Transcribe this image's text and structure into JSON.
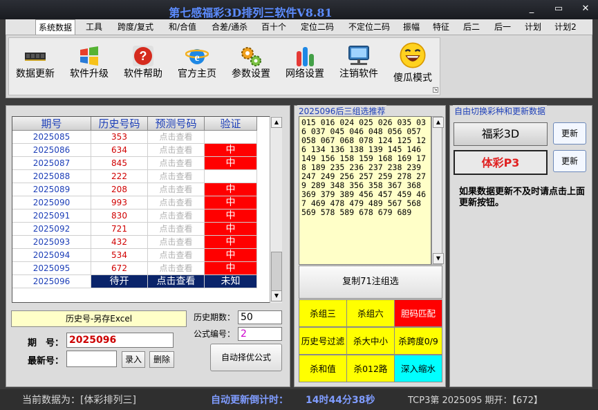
{
  "window": {
    "title": "第七感福彩3D排列三软件V8.81",
    "minimize": "_",
    "restore": "▭",
    "close": "✕"
  },
  "menu": [
    "系统数据",
    "工具",
    "跨度/复式",
    "和/合值",
    "合差/通杀",
    "百十个",
    "定位二码",
    "不定位二码",
    "振幅",
    "特征",
    "后二",
    "后一",
    "计划",
    "计划2"
  ],
  "toolbar": [
    {
      "label": "数据更新",
      "icon": "ram-chip-icon"
    },
    {
      "label": "软件升级",
      "icon": "windows-logo-icon"
    },
    {
      "label": "软件帮助",
      "icon": "help-question-icon"
    },
    {
      "label": "官方主页",
      "icon": "internet-explorer-icon"
    },
    {
      "label": "参数设置",
      "icon": "gears-icon"
    },
    {
      "label": "网络设置",
      "icon": "bar-chart-icon"
    },
    {
      "label": "注销软件",
      "icon": "monitor-network-icon"
    },
    {
      "label": "傻瓜模式",
      "icon": "laughing-face-icon"
    }
  ],
  "history": {
    "headers": [
      "期号",
      "历史号码",
      "预测号码",
      "验证"
    ],
    "rows": [
      {
        "period": "2025085",
        "history": "353",
        "predict": "点击查看",
        "verify": ""
      },
      {
        "period": "2025086",
        "history": "634",
        "predict": "点击查看",
        "verify": "中"
      },
      {
        "period": "2025087",
        "history": "845",
        "predict": "点击查看",
        "verify": "中"
      },
      {
        "period": "2025088",
        "history": "222",
        "predict": "点击查看",
        "verify": ""
      },
      {
        "period": "2025089",
        "history": "208",
        "predict": "点击查看",
        "verify": "中"
      },
      {
        "period": "2025090",
        "history": "993",
        "predict": "点击查看",
        "verify": "中"
      },
      {
        "period": "2025091",
        "history": "830",
        "predict": "点击查看",
        "verify": "中"
      },
      {
        "period": "2025092",
        "history": "721",
        "predict": "点击查看",
        "verify": "中"
      },
      {
        "period": "2025093",
        "history": "432",
        "predict": "点击查看",
        "verify": "中"
      },
      {
        "period": "2025094",
        "history": "534",
        "predict": "点击查看",
        "verify": "中"
      },
      {
        "period": "2025095",
        "history": "672",
        "predict": "点击查看",
        "verify": "中"
      },
      {
        "period": "2025096",
        "history": "待开",
        "predict": "点击查看",
        "verify": "未知"
      }
    ],
    "hit_color": "#ff0000",
    "selected_color": "#0a246a"
  },
  "controls": {
    "export_excel": "历史号-另存Excel",
    "period_label": "期　号：",
    "period_value": "2025096",
    "latest_label": "最新号：",
    "latest_value": "",
    "enter_btn": "录入",
    "delete_btn": "删除",
    "history_count_label": "历史期数：",
    "history_count_value": "50",
    "formula_label": "公式编号：",
    "formula_value": "2",
    "auto_formula_btn": "自动择优公式"
  },
  "combo": {
    "title": "2025096后三组选推荐",
    "numbers": "015 016 024 025 026 035 036 037 045 046 048 056 057 058 067 068 078 124 125 126 134 136 138 139 145 146 149 156 158 159 168 169 178 189 235 236 237 238 239 247 249 256 257 259 278 279 289 348 356 358 367 368 369 379 389 456 457 459 467 469 478 479 489 567 568 569 578 589 678 679 689",
    "copy_btn": "复制71注组选",
    "kill_buttons": [
      {
        "label": "杀组三",
        "color": "#ffff00",
        "text_color": "#000000"
      },
      {
        "label": "杀组六",
        "color": "#ffff00",
        "text_color": "#000000"
      },
      {
        "label": "胆码匹配",
        "color": "#ff0000",
        "text_color": "#ffffff"
      },
      {
        "label": "历史号过滤",
        "color": "#ffff00",
        "text_color": "#000000"
      },
      {
        "label": "杀大中小",
        "color": "#ffff00",
        "text_color": "#000000"
      },
      {
        "label": "杀跨度0/9",
        "color": "#ffff00",
        "text_color": "#000000"
      },
      {
        "label": "杀和值",
        "color": "#ffff00",
        "text_color": "#000000"
      },
      {
        "label": "杀012路",
        "color": "#ffff00",
        "text_color": "#000000"
      },
      {
        "label": "深入缩水",
        "color": "#00ffff",
        "text_color": "#000000"
      }
    ]
  },
  "lottery": {
    "title": "自由切换彩种和更新数据",
    "fc3d": "福彩3D",
    "p3": "体彩P3",
    "update_btn": "更新",
    "note": "如果数据更新不及时请点击上面更新按钮。"
  },
  "status": {
    "current": "当前数据为：[体彩排列三]",
    "countdown_label": "自动更新倒计时：",
    "countdown_value": "14时44分38秒",
    "last_draw": "TCP3第 2025095 期开：【672】"
  }
}
